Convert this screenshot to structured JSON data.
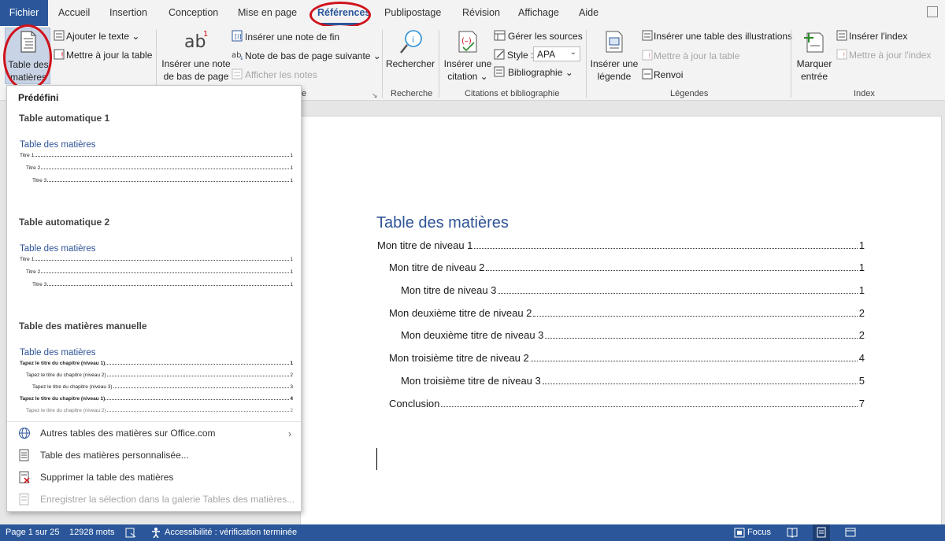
{
  "tabs": {
    "fichier": "Fichier",
    "accueil": "Accueil",
    "insertion": "Insertion",
    "conception": "Conception",
    "mise_en_page": "Mise en page",
    "references": "Références",
    "publipostage": "Publipostage",
    "revision": "Révision",
    "affichage": "Affichage",
    "aide": "Aide"
  },
  "ribbon": {
    "toc_button": {
      "line1": "Table des",
      "line2": "matières ⌄"
    },
    "ajouter_texte": "Ajouter le texte ⌄",
    "maj_table": "Mettre à jour la table",
    "inserer_note_line1": "Insérer une note",
    "inserer_note_line2": "de bas de page",
    "inserer_note_fin": "Insérer une note de fin",
    "note_suivante": "Note de bas de page suivante  ⌄",
    "afficher_notes": "Afficher les notes",
    "rechercher": "Rechercher",
    "inserer_citation_line1": "Insérer une",
    "inserer_citation_line2": "citation ⌄",
    "gerer_sources": "Gérer les sources",
    "style_label": "Style :",
    "style_value": "APA",
    "bibliographie": "Bibliographie ⌄",
    "inserer_legende_line1": "Insérer une",
    "inserer_legende_line2": "légende",
    "inserer_table_illus": "Insérer une table des illustrations",
    "maj_table_illus": "Mettre à jour la table",
    "renvoi": "Renvoi",
    "marquer_entree_line1": "Marquer",
    "marquer_entree_line2": "entrée",
    "inserer_index": "Insérer l'index",
    "maj_index": "Mettre à jour l'index",
    "groups": {
      "notes": "e",
      "recherche": "Recherche",
      "citations": "Citations et bibliographie",
      "legendes": "Légendes",
      "index": "Index"
    }
  },
  "dropdown": {
    "predefini": "Prédéfini",
    "auto1": {
      "heading": "Table automatique 1",
      "title": "Table des matières",
      "lines": [
        {
          "text": "Titre 1",
          "page": "1"
        },
        {
          "text": "Titre 2",
          "page": "1"
        },
        {
          "text": "Titre 3",
          "page": "1"
        }
      ]
    },
    "auto2": {
      "heading": "Table automatique 2",
      "title": "Table des matières",
      "lines": [
        {
          "text": "Titre 1",
          "page": "1"
        },
        {
          "text": "Titre 2",
          "page": "1"
        },
        {
          "text": "Titre 3",
          "page": "1"
        }
      ]
    },
    "manual": {
      "heading": "Table des matières manuelle",
      "title": "Table des matières",
      "lines": [
        {
          "text": "Tapez le titre du chapitre (niveau 1)",
          "page": "1"
        },
        {
          "text": "Tapez le titre du chapitre (niveau 2)",
          "page": "2"
        },
        {
          "text": "Tapez le titre du chapitre (niveau 3)",
          "page": "3"
        },
        {
          "text": "Tapez le titre du chapitre (niveau 1)",
          "page": "4"
        }
      ]
    },
    "items": {
      "autres": "Autres tables des matières sur Office.com",
      "personnalisee": "Table des matières personnalisée...",
      "supprimer": "Supprimer la table des matières",
      "enregistrer": "Enregistrer la sélection dans la galerie Tables des matières..."
    }
  },
  "document": {
    "title": "Table des matières",
    "entries": [
      {
        "text": "Mon titre de niveau 1",
        "page": "1"
      },
      {
        "text": "Mon titre de niveau 2",
        "page": "1"
      },
      {
        "text": "Mon titre de niveau 3",
        "page": "1"
      },
      {
        "text": "Mon deuxième titre de niveau 2",
        "page": "2"
      },
      {
        "text": "Mon deuxième titre de niveau 3",
        "page": "2"
      },
      {
        "text": "Mon troisième titre de niveau 2",
        "page": "4"
      },
      {
        "text": "Mon troisième titre de niveau 3",
        "page": "5"
      },
      {
        "text": "Conclusion",
        "page": "7"
      }
    ]
  },
  "status": {
    "page": "Page 1 sur 25",
    "words": "12928 mots",
    "accessibility": "Accessibilité : vérification terminée",
    "focus": "Focus"
  },
  "colors": {
    "accent": "#2b579a",
    "highlight_circle": "#d0121b",
    "heading_blue": "#2f5496"
  }
}
